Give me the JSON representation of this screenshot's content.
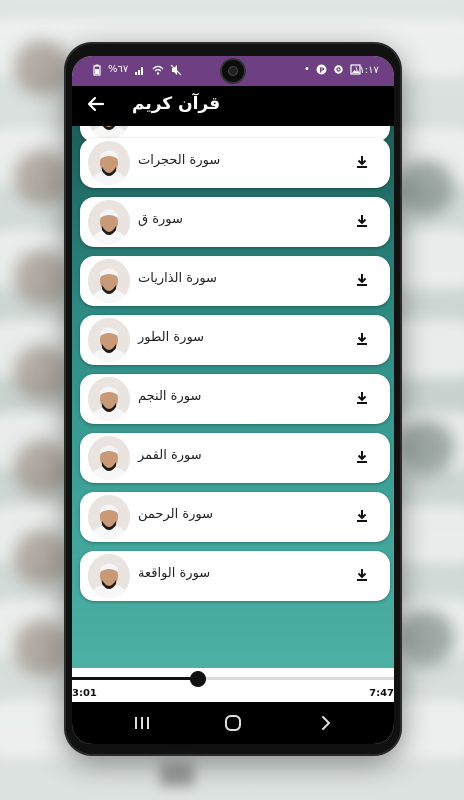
{
  "status_bar": {
    "time": "١١:١٧",
    "battery": "%٦٧",
    "left_icons": [
      "battery-icon",
      "signal-icon",
      "wifi-icon",
      "mute-icon"
    ],
    "right_icons": [
      "dot-icon",
      "p-icon",
      "settings-icon",
      "gallery-icon"
    ]
  },
  "app_bar": {
    "title": "قرآن كريم",
    "back_icon": "arrow-back-icon"
  },
  "list": {
    "items": [
      {
        "label": "سورة الحجرات"
      },
      {
        "label": "سورة ق"
      },
      {
        "label": "سورة الذاريات"
      },
      {
        "label": "سورة الطور"
      },
      {
        "label": "سورة النجم"
      },
      {
        "label": "سورة القمر"
      },
      {
        "label": "سورة الرحمن"
      },
      {
        "label": "سورة الواقعة"
      }
    ]
  },
  "player": {
    "current_time": "3:01",
    "total_time": "7:47",
    "progress": 0.39,
    "controls": [
      "repeat-icon",
      "previous-icon",
      "pause-icon",
      "next-icon",
      "shuffle-icon"
    ]
  },
  "navbar": {
    "buttons": [
      "recent-apps-icon",
      "home-icon",
      "back-nav-icon"
    ]
  },
  "colors": {
    "status_bar": "#6e3f82",
    "app_bar": "#000000",
    "list_bg": "#2e8a82",
    "card": "#ffffff"
  }
}
